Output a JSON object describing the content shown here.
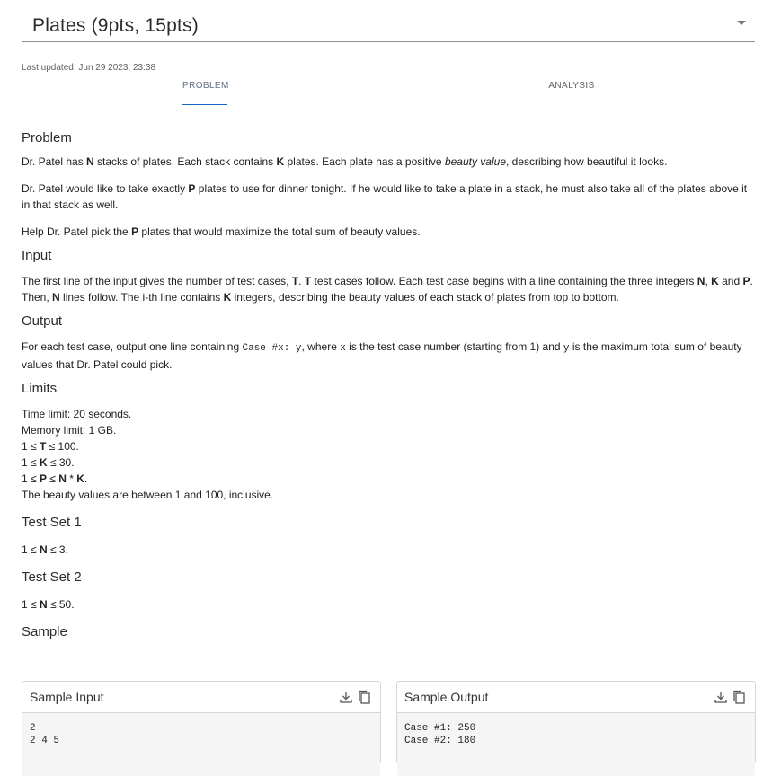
{
  "header": {
    "title": "Plates (9pts, 15pts)"
  },
  "meta": {
    "last_updated": "Last updated: Jun 29 2023, 23:38"
  },
  "tabs": [
    {
      "label": "PROBLEM"
    },
    {
      "label": "ANALYSIS"
    }
  ],
  "sections": {
    "problem": {
      "heading": "Problem",
      "p1": [
        "Dr. Patel has ",
        "N",
        " stacks of plates. Each stack contains ",
        "K",
        " plates. Each plate has a positive ",
        "beauty value",
        ", describing how beautiful it looks."
      ],
      "p2": [
        "Dr. Patel would like to take exactly ",
        "P",
        " plates to use for dinner tonight. If he would like to take a plate in a stack, he must also take all of the plates above it in that stack as well."
      ],
      "p3": [
        "Help Dr. Patel pick the ",
        "P",
        " plates that would maximize the total sum of beauty values."
      ]
    },
    "input": {
      "heading": "Input",
      "p": [
        "The first line of the input gives the number of test cases, ",
        "T",
        ". ",
        "T",
        " test cases follow. Each test case begins with a line containing the three integers ",
        "N",
        ", ",
        "K",
        " and ",
        "P",
        ". Then, ",
        "N",
        " lines follow. The i-th line contains ",
        "K",
        " integers, describing the beauty values of each stack of plates from top to bottom."
      ]
    },
    "output": {
      "heading": "Output",
      "p": [
        "For each test case, output one line containing ",
        "Case #x: y",
        ", where ",
        "x",
        " is the test case number (starting from 1) and ",
        "y",
        " is the maximum total sum of beauty values that Dr. Patel could pick."
      ]
    },
    "limits": {
      "heading": "Limits",
      "time": "Time limit: 20 seconds.",
      "memory": "Memory limit: 1 GB.",
      "t": [
        "1 ≤ ",
        "T",
        " ≤ 100."
      ],
      "k": [
        "1 ≤ ",
        "K",
        " ≤ 30."
      ],
      "p": [
        "1 ≤ ",
        "P",
        " ≤ ",
        "N",
        " * ",
        "K",
        "."
      ],
      "beauty": "The beauty values are between 1 and 100, inclusive."
    },
    "testset1": {
      "heading": "Test Set 1",
      "n": [
        "1 ≤ ",
        "N",
        " ≤ 3."
      ]
    },
    "testset2": {
      "heading": "Test Set 2",
      "n": [
        "1 ≤ ",
        "N",
        " ≤ 50."
      ]
    },
    "sample": {
      "heading": "Sample",
      "input_label": "Sample Input",
      "input_lines": [
        "2",
        "2 4 5"
      ],
      "output_label": "Sample Output",
      "output_lines": [
        "Case #1: 250",
        "Case #2: 180"
      ]
    }
  },
  "icons": {
    "download": "download-icon",
    "copy": "copy-icon"
  }
}
